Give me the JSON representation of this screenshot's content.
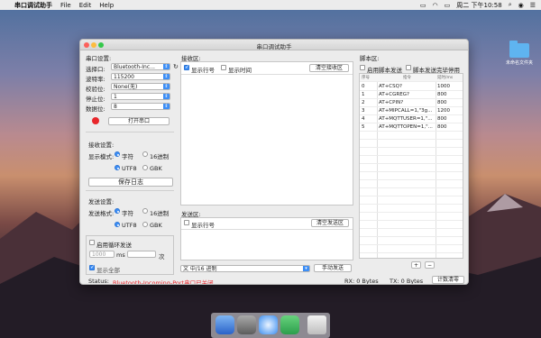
{
  "menubar": {
    "app_name": "串口调试助手",
    "menus": [
      "File",
      "Edit",
      "Help"
    ],
    "clock": "周二 下午10:58"
  },
  "desktop": {
    "folder_label": "未命名文件夹"
  },
  "window": {
    "title": "串口调试助手",
    "port_settings": {
      "heading": "串口设置:",
      "port_label": "选择口:",
      "port_value": "Bluetooth-Inc...",
      "baud_label": "波特率:",
      "baud_value": "115200",
      "parity_label": "校验位:",
      "parity_value": "None(无)",
      "stop_label": "停止位:",
      "stop_value": "1",
      "data_label": "数据位:",
      "data_value": "8",
      "open_button": "打开串口"
    },
    "receive_settings": {
      "heading": "接收设置:",
      "mode_label": "显示模式:",
      "opt_char": "字符",
      "opt_hex": "16进制",
      "opt_utf8": "UTF8",
      "opt_gbk": "GBK",
      "save_log_button": "保存日志"
    },
    "send_settings": {
      "heading": "发送设置:",
      "mode_label": "发送格式:",
      "opt_char": "字符",
      "opt_hex": "16进制",
      "opt_utf8": "UTF8",
      "opt_gbk": "GBK",
      "loop_label": "启用循环发送",
      "interval_value": "1000",
      "interval_unit": "ms",
      "count_unit": "次",
      "partial_hidden_label": "显示全部"
    },
    "receive_area": {
      "heading": "接收区:",
      "show_line_no": "显示行号",
      "show_time": "显示时间",
      "clear_button": "清空接收区"
    },
    "send_area": {
      "heading": "发送区:",
      "show_line_no": "显示行号",
      "clear_button": "清空发送区",
      "encoding_select": "文 中/16 进制",
      "send_button": "手动发送"
    },
    "script_area": {
      "heading": "脚本区:",
      "enable_send": "启用脚本发送",
      "stop_after": "脚本发送完毕停用",
      "columns": [
        "序号",
        "指令",
        "延时/ms"
      ],
      "rows": [
        {
          "idx": "0",
          "cmd": "AT+CSQ?",
          "delay": "1000"
        },
        {
          "idx": "1",
          "cmd": "AT+CGREG?",
          "delay": "800"
        },
        {
          "idx": "2",
          "cmd": "AT+CPIN?",
          "delay": "800"
        },
        {
          "idx": "3",
          "cmd": "AT+MIPCALL=1,\"3g...",
          "delay": "1200"
        },
        {
          "idx": "4",
          "cmd": "AT+MQTTUSER=1,\"...",
          "delay": "800"
        },
        {
          "idx": "5",
          "cmd": "AT+MQTTOPEN=1,\"...",
          "delay": "800"
        }
      ],
      "add_button": "+",
      "remove_button": "−"
    },
    "statusbar": {
      "status_label": "Status:",
      "status_value": "Bluetooth-Incoming-Port串口已关闭",
      "rx": "RX: 0 Bytes",
      "tx": "TX: 0 Bytes",
      "reset_button": "计数清零"
    }
  },
  "colors": {
    "accent": "#3d8ef5",
    "status_red": "#e8262b"
  }
}
